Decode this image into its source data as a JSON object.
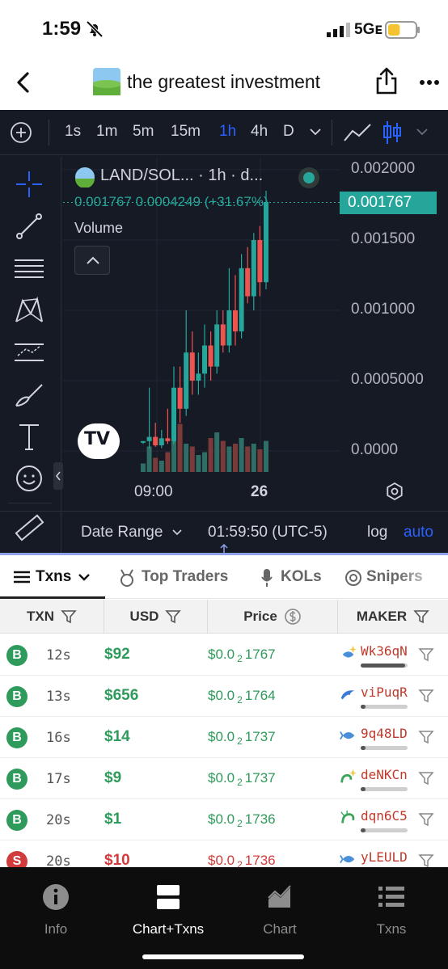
{
  "status_bar": {
    "time": "1:59",
    "network": "5Gᴇ",
    "battery_level": 0.45
  },
  "navbar": {
    "title": "the greatest investment"
  },
  "chart_toolbar": {
    "timeframes": [
      "1s",
      "1m",
      "5m",
      "15m",
      "1h",
      "4h",
      "D"
    ],
    "active_timeframe": "1h"
  },
  "chart_header": {
    "symbol": "LAND/SOL... · 1h · d...",
    "ohlc": "0.001767  0.0004249 (+31.67%)",
    "volume_label": "Volume",
    "last_price": "0.001767"
  },
  "chart_data": {
    "type": "candlestick",
    "title": "",
    "price_ticks": [
      "0.002000",
      "0.001500",
      "0.001000",
      "0.0005000",
      "0.0000"
    ],
    "ylim": [
      0,
      0.002
    ],
    "time_ticks": [
      "09:00",
      "26"
    ],
    "candles": [
      {
        "o": 6e-05,
        "h": 7e-05,
        "l": 5e-05,
        "c": 7e-05,
        "v": 0.15
      },
      {
        "o": 7e-05,
        "h": 0.00045,
        "l": 2e-05,
        "c": 0.0001,
        "v": 0.45
      },
      {
        "o": 0.0001,
        "h": 0.0002,
        "l": 3e-05,
        "c": 4e-05,
        "v": 0.25
      },
      {
        "o": 4e-05,
        "h": 0.00015,
        "l": 2e-05,
        "c": 9e-05,
        "v": 0.2
      },
      {
        "o": 9e-05,
        "h": 0.0003,
        "l": 5e-05,
        "c": 7e-05,
        "v": 0.35
      },
      {
        "o": 7e-05,
        "h": 0.0006,
        "l": 5e-05,
        "c": 0.00045,
        "v": 0.6
      },
      {
        "o": 0.00045,
        "h": 0.0006,
        "l": 0.0002,
        "c": 0.0003,
        "v": 0.85
      },
      {
        "o": 0.0003,
        "h": 0.001,
        "l": 0.00025,
        "c": 0.0007,
        "v": 0.5
      },
      {
        "o": 0.0007,
        "h": 0.00085,
        "l": 0.0004,
        "c": 0.0005,
        "v": 0.45
      },
      {
        "o": 0.0005,
        "h": 0.0007,
        "l": 0.0004,
        "c": 0.00055,
        "v": 0.3
      },
      {
        "o": 0.00055,
        "h": 0.0009,
        "l": 0.00045,
        "c": 0.00075,
        "v": 0.35
      },
      {
        "o": 0.00075,
        "h": 0.00085,
        "l": 0.0005,
        "c": 0.0006,
        "v": 0.6
      },
      {
        "o": 0.0006,
        "h": 0.001,
        "l": 0.00055,
        "c": 0.0009,
        "v": 0.7
      },
      {
        "o": 0.0009,
        "h": 0.001,
        "l": 0.0007,
        "c": 0.00075,
        "v": 0.55
      },
      {
        "o": 0.00075,
        "h": 0.0013,
        "l": 0.0007,
        "c": 0.001,
        "v": 0.45
      },
      {
        "o": 0.001,
        "h": 0.00125,
        "l": 0.00075,
        "c": 0.00085,
        "v": 0.5
      },
      {
        "o": 0.00085,
        "h": 0.0014,
        "l": 0.0008,
        "c": 0.0013,
        "v": 0.6
      },
      {
        "o": 0.0013,
        "h": 0.00145,
        "l": 0.00105,
        "c": 0.0011,
        "v": 0.45
      },
      {
        "o": 0.0011,
        "h": 0.00155,
        "l": 0.001,
        "c": 0.0015,
        "v": 0.5
      },
      {
        "o": 0.0015,
        "h": 0.0016,
        "l": 0.0011,
        "c": 0.0012,
        "v": 0.4
      },
      {
        "o": 0.0012,
        "h": 0.00185,
        "l": 0.00115,
        "c": 0.00177,
        "v": 0.55
      }
    ]
  },
  "chart_bottom": {
    "date_range": "Date Range",
    "clock": "01:59:50 (UTC-5)",
    "log": "log",
    "auto": "auto"
  },
  "tabs": [
    "Txns",
    "Top Traders",
    "KOLs",
    "Snipers"
  ],
  "table": {
    "headers": [
      "TXN",
      "USD",
      "Price",
      "MAKER"
    ],
    "rows": [
      {
        "type": "B",
        "age": "12s",
        "usd": "$92",
        "price_a": "$0.0",
        "price_sub": "2",
        "price_b": "1767",
        "maker": "Wk36qN",
        "maker_fill": 0.95,
        "icon": "sparkle-fish-icon"
      },
      {
        "type": "B",
        "age": "13s",
        "usd": "$656",
        "price_a": "$0.0",
        "price_sub": "2",
        "price_b": "1764",
        "maker": "viPuqR",
        "maker_fill": 0.1,
        "icon": "dolphin-icon"
      },
      {
        "type": "B",
        "age": "16s",
        "usd": "$14",
        "price_a": "$0.0",
        "price_sub": "2",
        "price_b": "1737",
        "maker": "9q48LD",
        "maker_fill": 0.1,
        "icon": "fish-icon"
      },
      {
        "type": "B",
        "age": "17s",
        "usd": "$9",
        "price_a": "$0.0",
        "price_sub": "2",
        "price_b": "1737",
        "maker": "deNKCn",
        "maker_fill": 0.1,
        "icon": "sparkle-shrimp-icon"
      },
      {
        "type": "B",
        "age": "20s",
        "usd": "$1",
        "price_a": "$0.0",
        "price_sub": "2",
        "price_b": "1736",
        "maker": "dqn6C5",
        "maker_fill": 0.1,
        "icon": "shrimp-icon"
      },
      {
        "type": "S",
        "age": "20s",
        "usd": "$10",
        "price_a": "$0.0",
        "price_sub": "2",
        "price_b": "1736",
        "maker": "yLEULD",
        "maker_fill": 0.1,
        "icon": "fish-icon"
      }
    ]
  },
  "bottom_nav": [
    {
      "label": "Info",
      "icon": "info-icon"
    },
    {
      "label": "Chart+Txns",
      "icon": "split-view-icon"
    },
    {
      "label": "Chart",
      "icon": "area-chart-icon"
    },
    {
      "label": "Txns",
      "icon": "list-icon"
    }
  ],
  "colors": {
    "up": "#26a69a",
    "down": "#ef5350",
    "buy": "#2e9a5b",
    "sell": "#d23b3b",
    "chart_bg": "#161a25"
  }
}
